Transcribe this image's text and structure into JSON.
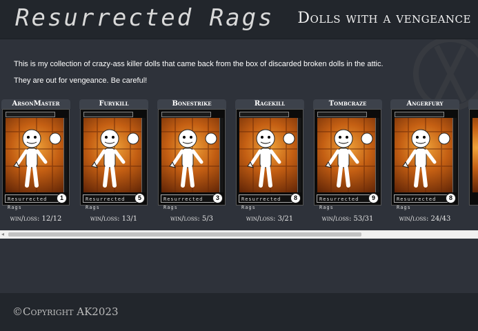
{
  "header": {
    "logo_text": "Resurrected Rags",
    "tagline": "Dolls with a vengeance"
  },
  "intro": {
    "line1": "This is my collection of crazy-ass killer dolls that came back from the box of discarded broken dolls in the attic.",
    "line2": "They are out for vengeance. Be careful!"
  },
  "cards": [
    {
      "name": "ArsonMaster",
      "number": "1",
      "footer_label": "Resurrected Rags",
      "stats": "win/loss: 12/12"
    },
    {
      "name": "Furykill",
      "number": "5",
      "footer_label": "Resurrected Rags",
      "stats": "win/loss: 13/1"
    },
    {
      "name": "Bonestrike",
      "number": "3",
      "footer_label": "Resurrected Rags",
      "stats": "win/loss: 5/3"
    },
    {
      "name": "Ragekill",
      "number": "8",
      "footer_label": "Resurrected Rags",
      "stats": "win/loss: 3/21"
    },
    {
      "name": "Tombcraze",
      "number": "9",
      "footer_label": "Resurrected Rags",
      "stats": "win/loss: 53/31"
    },
    {
      "name": "Angerfury",
      "number": "8",
      "footer_label": "Resurrected Rags",
      "stats": "win/loss: 24/43"
    }
  ],
  "footer": {
    "copyright": "©Copyright AK2023"
  },
  "colors": {
    "header_bg": "#22262c",
    "main_bg": "#2e323a",
    "card_art": "#c45f13"
  }
}
